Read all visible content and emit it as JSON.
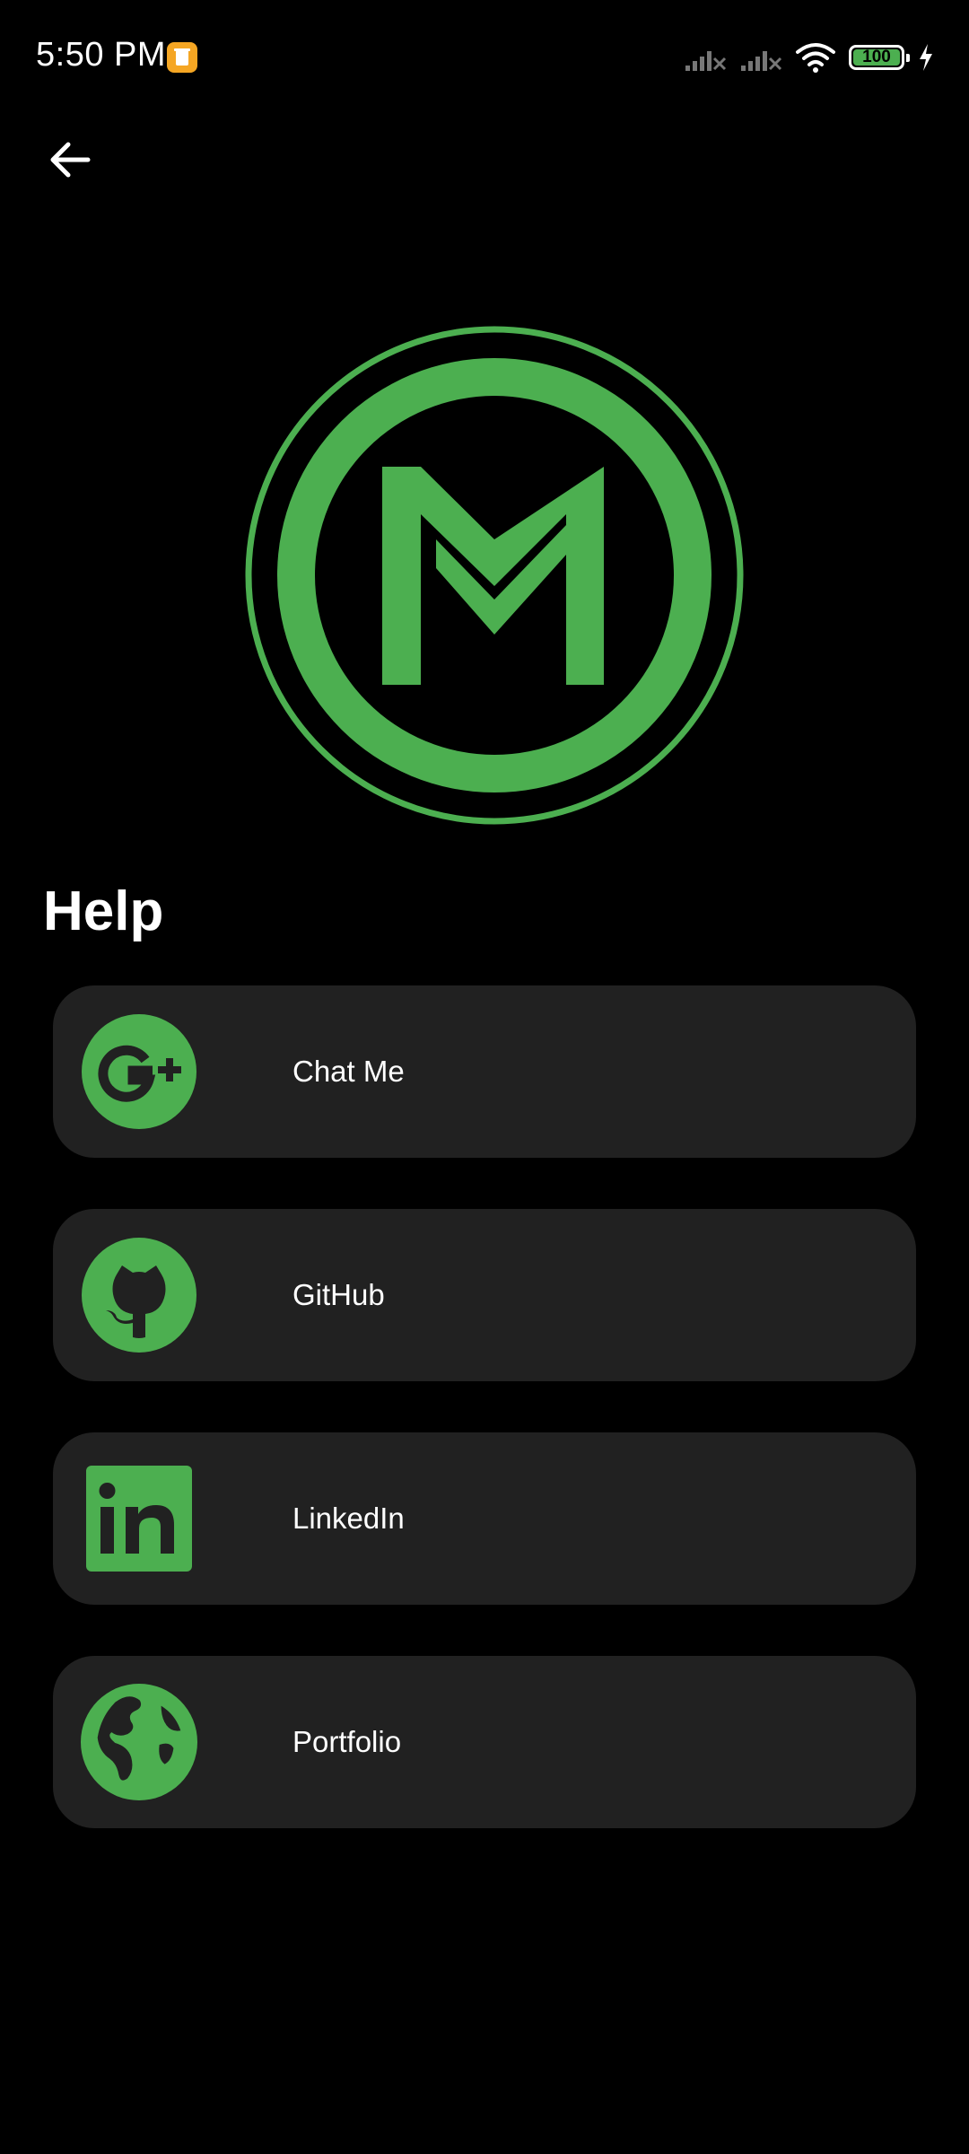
{
  "status_bar": {
    "time": "5:50 PM",
    "battery_level": "100",
    "icons": [
      "notification-icon",
      "signal-icon-1",
      "signal-icon-2",
      "wifi-icon",
      "battery-icon",
      "charging-icon"
    ]
  },
  "header": {
    "back_icon": "arrow-left-icon"
  },
  "logo": {
    "name": "m-logo",
    "color": "#4caf50"
  },
  "help": {
    "title": "Help",
    "items": [
      {
        "label": "Chat Me",
        "icon": "google-plus-icon"
      },
      {
        "label": "GitHub",
        "icon": "github-icon"
      },
      {
        "label": "LinkedIn",
        "icon": "linkedin-icon"
      },
      {
        "label": "Portfolio",
        "icon": "globe-icon"
      }
    ]
  },
  "colors": {
    "background": "#000000",
    "card": "#212121",
    "accent": "#4caf50",
    "text": "#ffffff"
  }
}
